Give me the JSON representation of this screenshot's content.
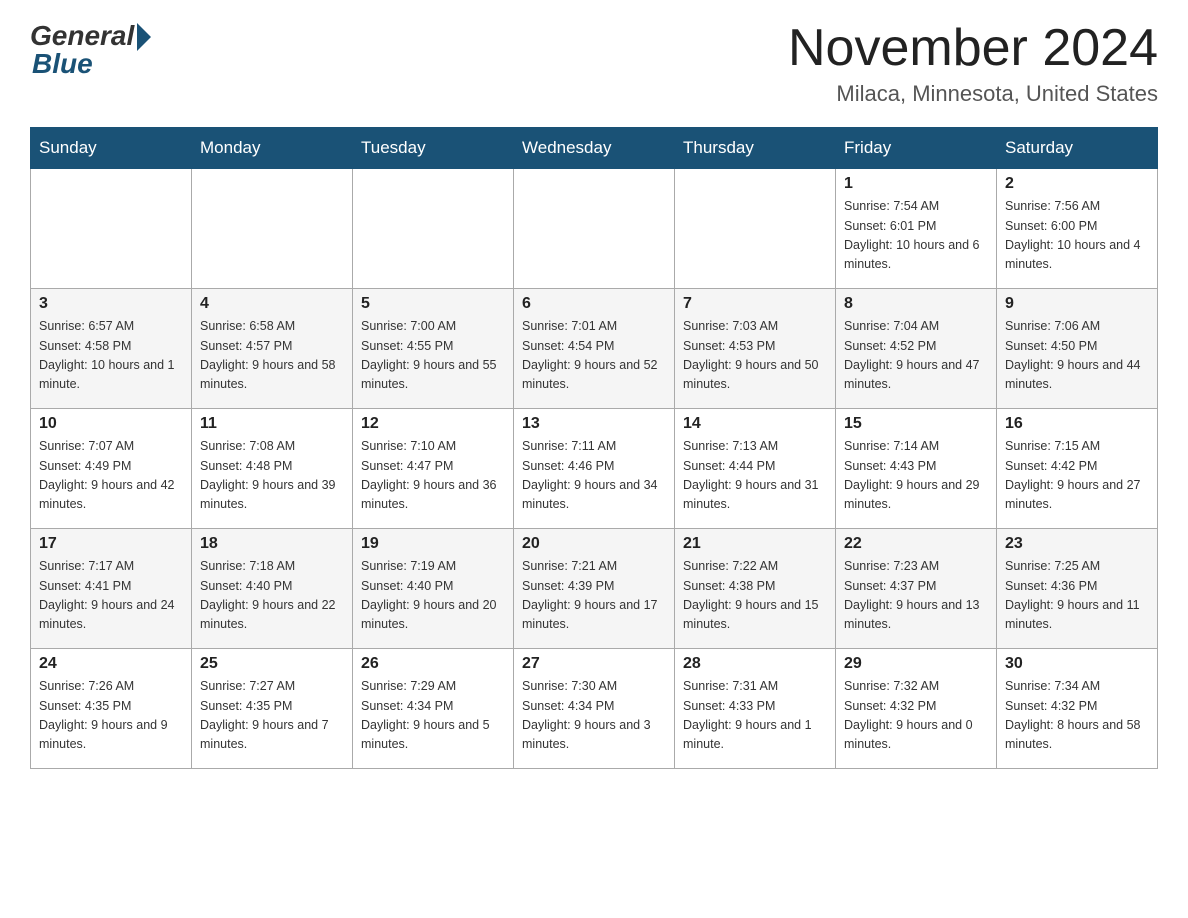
{
  "header": {
    "logo_general": "General",
    "logo_blue": "Blue",
    "title": "November 2024",
    "location": "Milaca, Minnesota, United States"
  },
  "days_of_week": [
    "Sunday",
    "Monday",
    "Tuesday",
    "Wednesday",
    "Thursday",
    "Friday",
    "Saturday"
  ],
  "weeks": [
    [
      {
        "day": "",
        "info": ""
      },
      {
        "day": "",
        "info": ""
      },
      {
        "day": "",
        "info": ""
      },
      {
        "day": "",
        "info": ""
      },
      {
        "day": "",
        "info": ""
      },
      {
        "day": "1",
        "info": "Sunrise: 7:54 AM\nSunset: 6:01 PM\nDaylight: 10 hours and 6 minutes."
      },
      {
        "day": "2",
        "info": "Sunrise: 7:56 AM\nSunset: 6:00 PM\nDaylight: 10 hours and 4 minutes."
      }
    ],
    [
      {
        "day": "3",
        "info": "Sunrise: 6:57 AM\nSunset: 4:58 PM\nDaylight: 10 hours and 1 minute."
      },
      {
        "day": "4",
        "info": "Sunrise: 6:58 AM\nSunset: 4:57 PM\nDaylight: 9 hours and 58 minutes."
      },
      {
        "day": "5",
        "info": "Sunrise: 7:00 AM\nSunset: 4:55 PM\nDaylight: 9 hours and 55 minutes."
      },
      {
        "day": "6",
        "info": "Sunrise: 7:01 AM\nSunset: 4:54 PM\nDaylight: 9 hours and 52 minutes."
      },
      {
        "day": "7",
        "info": "Sunrise: 7:03 AM\nSunset: 4:53 PM\nDaylight: 9 hours and 50 minutes."
      },
      {
        "day": "8",
        "info": "Sunrise: 7:04 AM\nSunset: 4:52 PM\nDaylight: 9 hours and 47 minutes."
      },
      {
        "day": "9",
        "info": "Sunrise: 7:06 AM\nSunset: 4:50 PM\nDaylight: 9 hours and 44 minutes."
      }
    ],
    [
      {
        "day": "10",
        "info": "Sunrise: 7:07 AM\nSunset: 4:49 PM\nDaylight: 9 hours and 42 minutes."
      },
      {
        "day": "11",
        "info": "Sunrise: 7:08 AM\nSunset: 4:48 PM\nDaylight: 9 hours and 39 minutes."
      },
      {
        "day": "12",
        "info": "Sunrise: 7:10 AM\nSunset: 4:47 PM\nDaylight: 9 hours and 36 minutes."
      },
      {
        "day": "13",
        "info": "Sunrise: 7:11 AM\nSunset: 4:46 PM\nDaylight: 9 hours and 34 minutes."
      },
      {
        "day": "14",
        "info": "Sunrise: 7:13 AM\nSunset: 4:44 PM\nDaylight: 9 hours and 31 minutes."
      },
      {
        "day": "15",
        "info": "Sunrise: 7:14 AM\nSunset: 4:43 PM\nDaylight: 9 hours and 29 minutes."
      },
      {
        "day": "16",
        "info": "Sunrise: 7:15 AM\nSunset: 4:42 PM\nDaylight: 9 hours and 27 minutes."
      }
    ],
    [
      {
        "day": "17",
        "info": "Sunrise: 7:17 AM\nSunset: 4:41 PM\nDaylight: 9 hours and 24 minutes."
      },
      {
        "day": "18",
        "info": "Sunrise: 7:18 AM\nSunset: 4:40 PM\nDaylight: 9 hours and 22 minutes."
      },
      {
        "day": "19",
        "info": "Sunrise: 7:19 AM\nSunset: 4:40 PM\nDaylight: 9 hours and 20 minutes."
      },
      {
        "day": "20",
        "info": "Sunrise: 7:21 AM\nSunset: 4:39 PM\nDaylight: 9 hours and 17 minutes."
      },
      {
        "day": "21",
        "info": "Sunrise: 7:22 AM\nSunset: 4:38 PM\nDaylight: 9 hours and 15 minutes."
      },
      {
        "day": "22",
        "info": "Sunrise: 7:23 AM\nSunset: 4:37 PM\nDaylight: 9 hours and 13 minutes."
      },
      {
        "day": "23",
        "info": "Sunrise: 7:25 AM\nSunset: 4:36 PM\nDaylight: 9 hours and 11 minutes."
      }
    ],
    [
      {
        "day": "24",
        "info": "Sunrise: 7:26 AM\nSunset: 4:35 PM\nDaylight: 9 hours and 9 minutes."
      },
      {
        "day": "25",
        "info": "Sunrise: 7:27 AM\nSunset: 4:35 PM\nDaylight: 9 hours and 7 minutes."
      },
      {
        "day": "26",
        "info": "Sunrise: 7:29 AM\nSunset: 4:34 PM\nDaylight: 9 hours and 5 minutes."
      },
      {
        "day": "27",
        "info": "Sunrise: 7:30 AM\nSunset: 4:34 PM\nDaylight: 9 hours and 3 minutes."
      },
      {
        "day": "28",
        "info": "Sunrise: 7:31 AM\nSunset: 4:33 PM\nDaylight: 9 hours and 1 minute."
      },
      {
        "day": "29",
        "info": "Sunrise: 7:32 AM\nSunset: 4:32 PM\nDaylight: 9 hours and 0 minutes."
      },
      {
        "day": "30",
        "info": "Sunrise: 7:34 AM\nSunset: 4:32 PM\nDaylight: 8 hours and 58 minutes."
      }
    ]
  ]
}
